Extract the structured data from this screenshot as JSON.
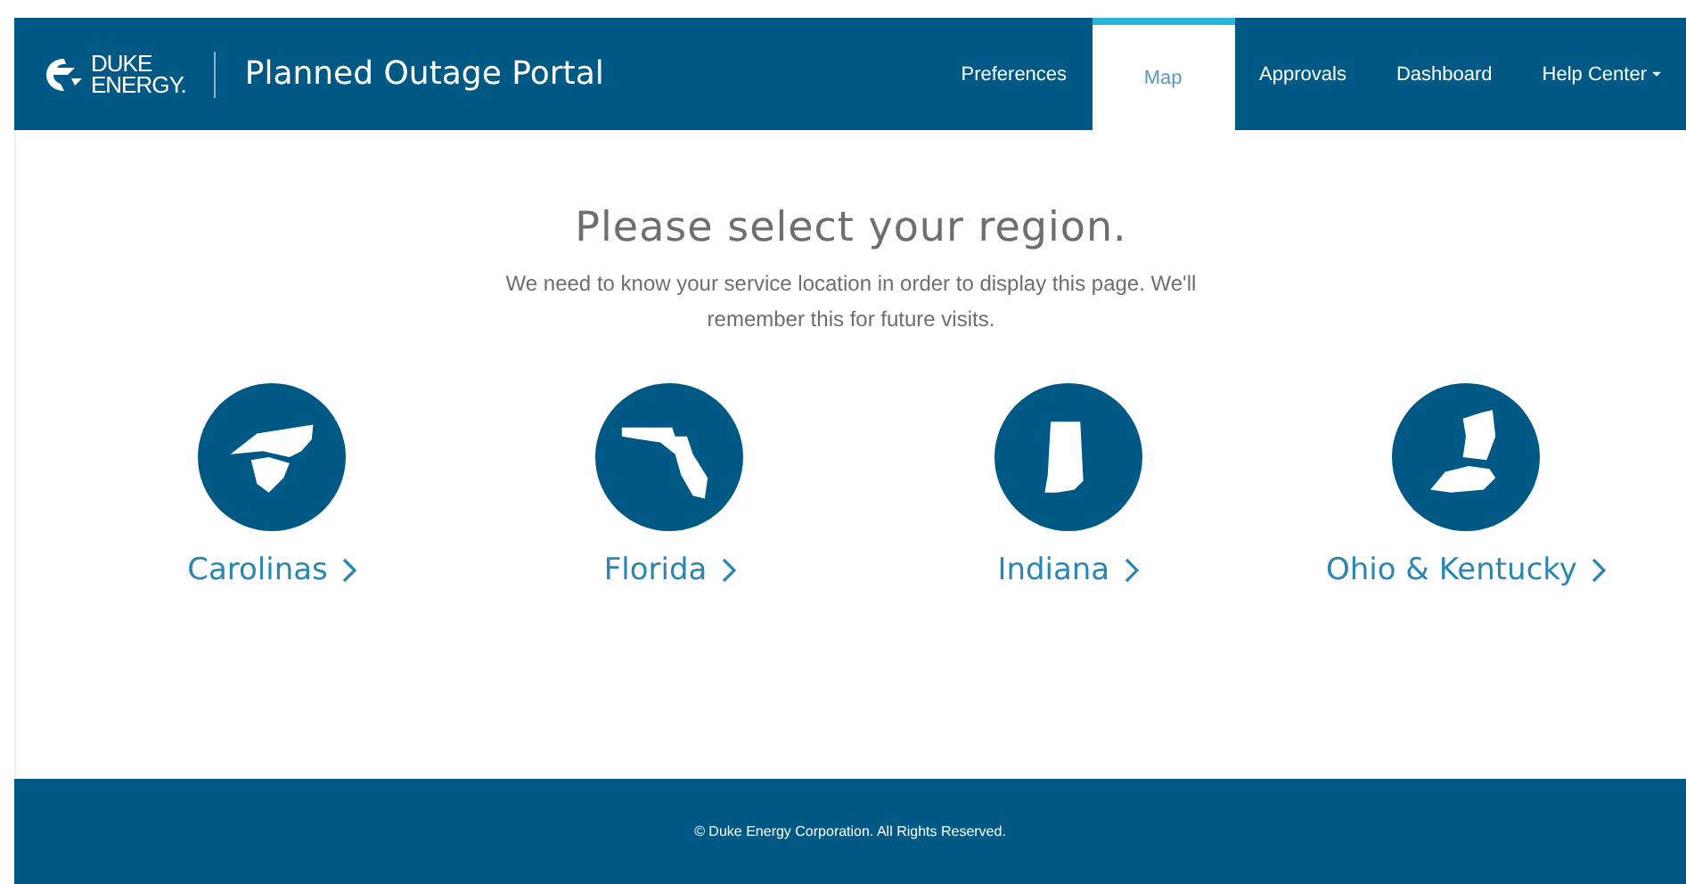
{
  "header": {
    "logo": {
      "line_1": "DUKE",
      "line_2": "ENERGY."
    },
    "title": "Planned Outage Portal",
    "nav": [
      {
        "label": "Preferences",
        "selected": false,
        "dropdown": false
      },
      {
        "label": "Map",
        "selected": true,
        "dropdown": false
      },
      {
        "label": "Approvals",
        "selected": false,
        "dropdown": false
      },
      {
        "label": "Dashboard",
        "selected": false,
        "dropdown": false
      },
      {
        "label": "Help Center",
        "selected": false,
        "dropdown": true
      }
    ]
  },
  "heading": "Please select your region.",
  "intro": "We need to know your service location in order to display this page. We'll remember this for future visits.",
  "regions": [
    {
      "label": "Carolinas",
      "kind": "carolinas"
    },
    {
      "label": "Florida",
      "kind": "florida"
    },
    {
      "label": "Indiana",
      "kind": "indiana"
    },
    {
      "label": "Ohio & Kentucky",
      "kind": "ohio-kentucky"
    }
  ],
  "footer": "© Duke Energy Corporation. All Rights Reserved."
}
